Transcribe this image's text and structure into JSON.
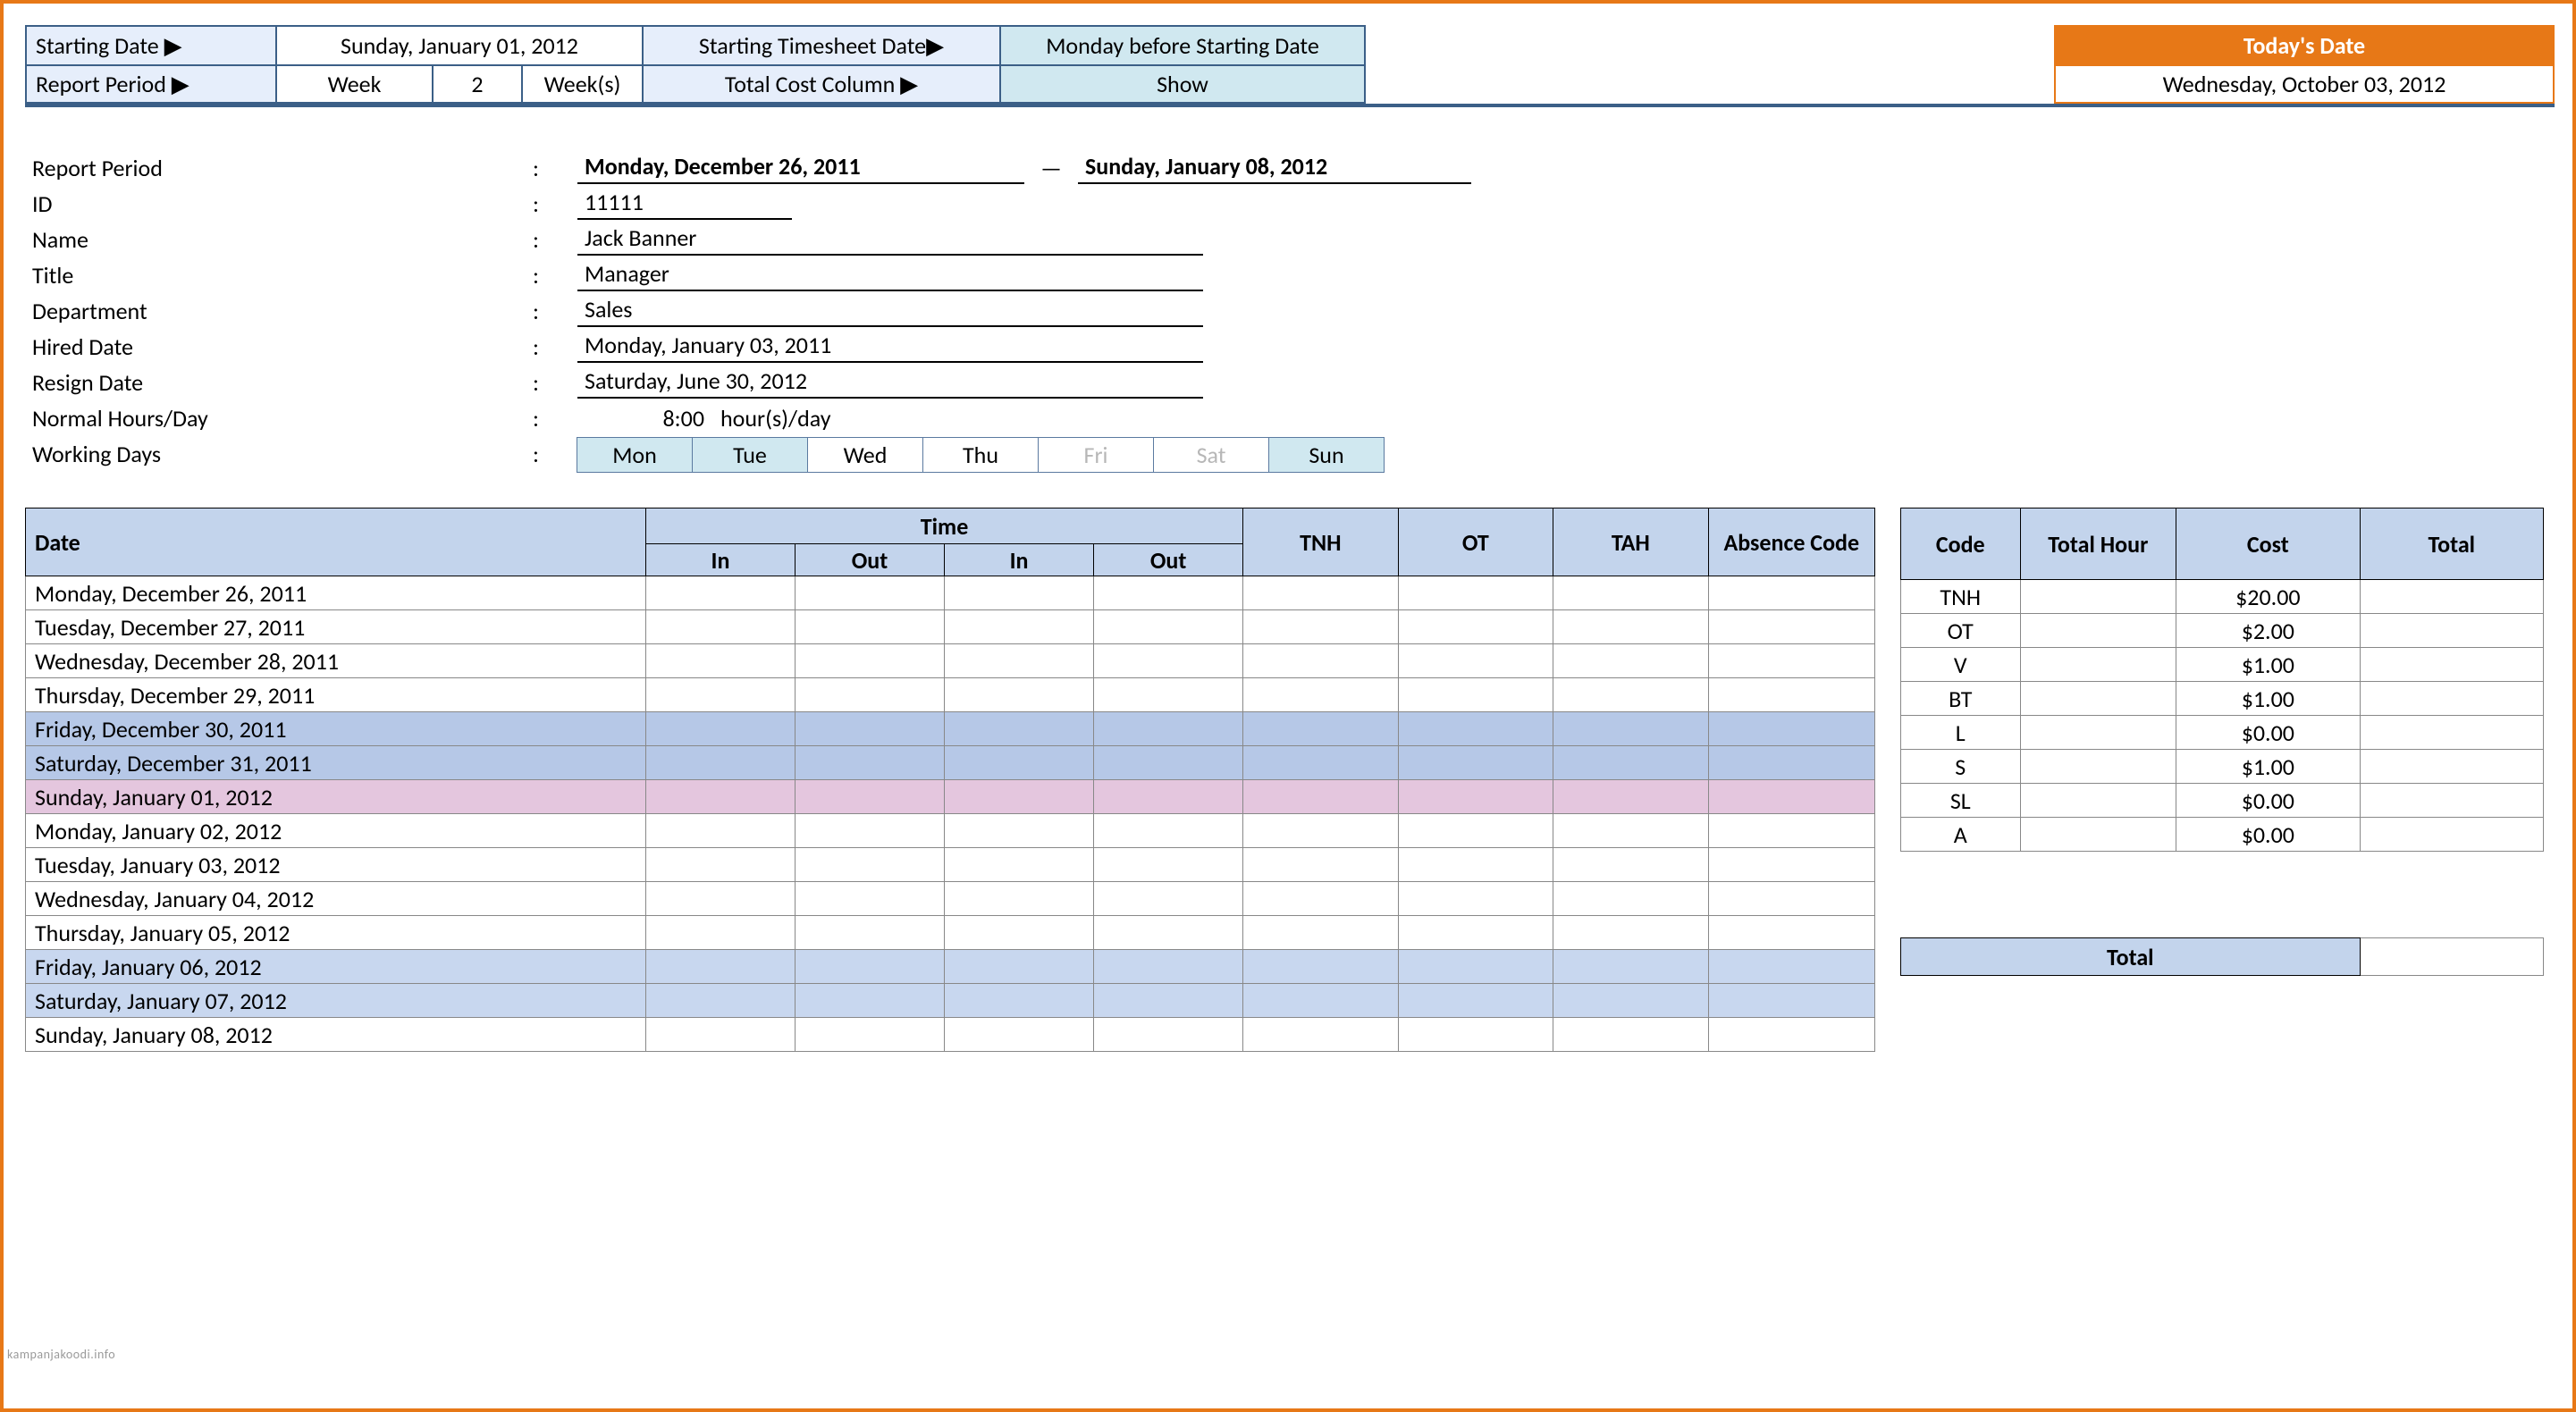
{
  "config": {
    "starting_date_label": "Starting Date ▶",
    "starting_date_value": "Sunday, January 01, 2012",
    "starting_ts_label": "Starting Timesheet Date▶",
    "starting_ts_value": "Monday before Starting Date",
    "report_period_label": "Report Period ▶",
    "report_period_unit": "Week",
    "report_period_count": "2",
    "report_period_suffix": "Week(s)",
    "total_cost_label": "Total Cost Column ▶",
    "total_cost_value": "Show",
    "today_label": "Today's Date",
    "today_value": "Wednesday, October 03, 2012"
  },
  "info": {
    "labels": {
      "report_period": "Report Period",
      "id": "ID",
      "name": "Name",
      "title": "Title",
      "department": "Department",
      "hired": "Hired Date",
      "resign": "Resign Date",
      "normal_hours": "Normal Hours/Day",
      "working_days": "Working Days"
    },
    "colon": ":",
    "report_period_start": "Monday, December 26, 2011",
    "report_period_end": "Sunday, January 08, 2012",
    "dash": "—",
    "id": "11111",
    "name": "Jack Banner",
    "title": "Manager",
    "department": "Sales",
    "hired": "Monday, January 03, 2011",
    "resign": "Saturday, June 30, 2012",
    "normal_hours_value": "8:00",
    "normal_hours_unit": "hour(s)/day",
    "days": {
      "mon": "Mon",
      "tue": "Tue",
      "wed": "Wed",
      "thu": "Thu",
      "fri": "Fri",
      "sat": "Sat",
      "sun": "Sun"
    }
  },
  "timesheet": {
    "headers": {
      "date": "Date",
      "time": "Time",
      "in": "In",
      "out": "Out",
      "tnh": "TNH",
      "ot": "OT",
      "tah": "TAH",
      "absence": "Absence Code"
    },
    "rows": [
      {
        "date": "Monday, December 26, 2011",
        "shade": ""
      },
      {
        "date": "Tuesday, December 27, 2011",
        "shade": ""
      },
      {
        "date": "Wednesday, December 28, 2011",
        "shade": ""
      },
      {
        "date": "Thursday, December 29, 2011",
        "shade": ""
      },
      {
        "date": "Friday, December 30, 2011",
        "shade": "blue"
      },
      {
        "date": "Saturday, December 31, 2011",
        "shade": "blue"
      },
      {
        "date": "Sunday, January 01, 2012",
        "shade": "pink"
      },
      {
        "date": "Monday, January 02, 2012",
        "shade": ""
      },
      {
        "date": "Tuesday, January 03, 2012",
        "shade": ""
      },
      {
        "date": "Wednesday, January 04, 2012",
        "shade": ""
      },
      {
        "date": "Thursday, January 05, 2012",
        "shade": ""
      },
      {
        "date": "Friday, January 06, 2012",
        "shade": "alt"
      },
      {
        "date": "Saturday, January 07, 2012",
        "shade": "alt"
      },
      {
        "date": "Sunday, January 08, 2012",
        "shade": ""
      }
    ]
  },
  "summary": {
    "headers": {
      "code": "Code",
      "hour": "Total Hour",
      "cost": "Cost",
      "total": "Total"
    },
    "rows": [
      {
        "code": "TNH",
        "hour": "",
        "cost": "$20.00",
        "total": ""
      },
      {
        "code": "OT",
        "hour": "",
        "cost": "$2.00",
        "total": ""
      },
      {
        "code": "V",
        "hour": "",
        "cost": "$1.00",
        "total": ""
      },
      {
        "code": "BT",
        "hour": "",
        "cost": "$1.00",
        "total": ""
      },
      {
        "code": "L",
        "hour": "",
        "cost": "$0.00",
        "total": ""
      },
      {
        "code": "S",
        "hour": "",
        "cost": "$1.00",
        "total": ""
      },
      {
        "code": "SL",
        "hour": "",
        "cost": "$0.00",
        "total": ""
      },
      {
        "code": "A",
        "hour": "",
        "cost": "$0.00",
        "total": ""
      }
    ],
    "grand_label": "Total",
    "grand_value": ""
  },
  "watermark": "kampanjakoodi.info"
}
